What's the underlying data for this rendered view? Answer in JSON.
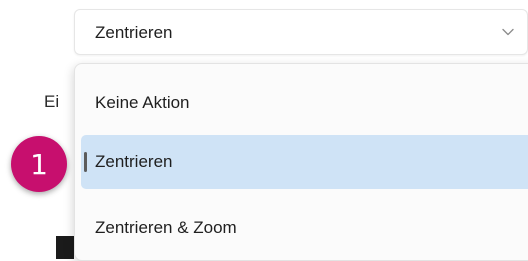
{
  "background": {
    "left_text": "Ei"
  },
  "combo": {
    "value": "Zentrieren",
    "chevron_icon": "chevron-down-icon"
  },
  "dropdown": {
    "options": [
      {
        "label": "Keine Aktion",
        "selected": false
      },
      {
        "label": "Zentrieren",
        "selected": true
      },
      {
        "label": "Zentrieren & Zoom",
        "selected": false
      }
    ]
  },
  "badge": {
    "number": "1",
    "color": "#c70f6e"
  },
  "colors": {
    "selected_option_bg": "#cfe3f6",
    "selection_indicator": "#5c5c5c"
  }
}
